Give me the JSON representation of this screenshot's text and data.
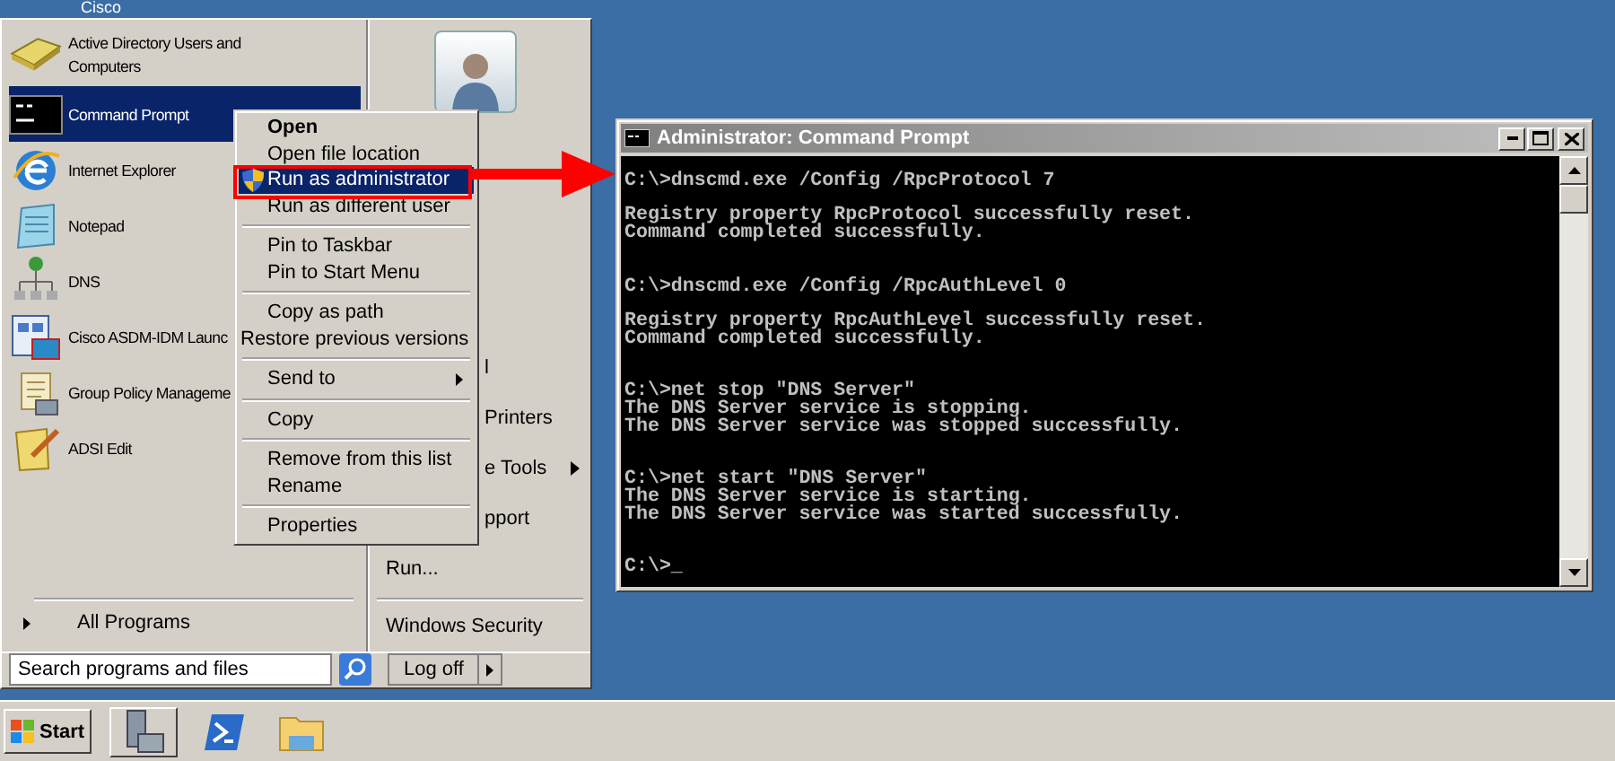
{
  "desktop": {
    "icon_label": "Cisco"
  },
  "start_menu": {
    "programs": [
      {
        "label": "Active Directory Users and Computers",
        "selected": false
      },
      {
        "label": "Command Prompt",
        "selected": true
      },
      {
        "label": "Internet Explorer",
        "selected": false
      },
      {
        "label": "Notepad",
        "selected": false
      },
      {
        "label": "DNS",
        "selected": false
      },
      {
        "label": "Cisco ASDM-IDM Launc",
        "selected": false
      },
      {
        "label": "Group Policy Manageme",
        "selected": false
      },
      {
        "label": "ADSI Edit",
        "selected": false
      }
    ],
    "all_programs": "All Programs",
    "search": {
      "placeholder": "Search programs and files"
    },
    "right_items": [
      {
        "label": "l",
        "kind": "covered",
        "has_submenu": false
      },
      {
        "label": "Printers",
        "kind": "covered",
        "has_submenu": false
      },
      {
        "label": "e Tools",
        "kind": "covered",
        "has_submenu": true
      },
      {
        "label": "pport",
        "kind": "covered",
        "has_submenu": false
      },
      {
        "label": "Run...",
        "kind": "item",
        "has_submenu": false
      },
      {
        "label": "Windows Security",
        "kind": "item",
        "has_submenu": false
      }
    ],
    "log_off": "Log off"
  },
  "context_menu": {
    "groups": [
      [
        {
          "label": "Open",
          "default": true,
          "selected": false,
          "has_submenu": false
        },
        {
          "label": "Open file location",
          "default": false,
          "selected": false,
          "has_submenu": false
        },
        {
          "label": "Run as administrator",
          "default": false,
          "selected": true,
          "has_submenu": false
        },
        {
          "label": "Run as different user",
          "default": false,
          "selected": false,
          "has_submenu": false
        }
      ],
      [
        {
          "label": "Pin to Taskbar",
          "default": false,
          "selected": false,
          "has_submenu": false
        },
        {
          "label": "Pin to Start Menu",
          "default": false,
          "selected": false,
          "has_submenu": false
        }
      ],
      [
        {
          "label": "Copy as path",
          "default": false,
          "selected": false,
          "has_submenu": false
        },
        {
          "label": "Restore previous versions",
          "default": false,
          "selected": false,
          "has_submenu": false
        }
      ],
      [
        {
          "label": "Send to",
          "default": false,
          "selected": false,
          "has_submenu": true
        }
      ],
      [
        {
          "label": "Copy",
          "default": false,
          "selected": false,
          "has_submenu": false
        }
      ],
      [
        {
          "label": "Remove from this list",
          "default": false,
          "selected": false,
          "has_submenu": false
        },
        {
          "label": "Rename",
          "default": false,
          "selected": false,
          "has_submenu": false
        }
      ],
      [
        {
          "label": "Properties",
          "default": false,
          "selected": false,
          "has_submenu": false
        }
      ]
    ]
  },
  "console": {
    "title": "Administrator: Command Prompt",
    "blocks": [
      {
        "wide_gap": false,
        "lines": [
          "C:\\>dnscmd.exe /Config /RpcProtocol 7"
        ]
      },
      {
        "wide_gap": false,
        "lines": [
          "Registry property RpcProtocol successfully reset.",
          "Command completed successfully."
        ]
      },
      {
        "wide_gap": true,
        "lines": [
          "C:\\>dnscmd.exe /Config /RpcAuthLevel 0"
        ]
      },
      {
        "wide_gap": false,
        "lines": [
          "Registry property RpcAuthLevel successfully reset.",
          "Command completed successfully."
        ]
      },
      {
        "wide_gap": true,
        "lines": [
          "C:\\>net stop \"DNS Server\"",
          "The DNS Server service is stopping.",
          "The DNS Server service was stopped successfully."
        ]
      },
      {
        "wide_gap": true,
        "lines": [
          "C:\\>net start \"DNS Server\"",
          "The DNS Server service is starting.",
          "The DNS Server service was started successfully."
        ]
      },
      {
        "wide_gap": true,
        "lines": [
          "C:\\>_"
        ]
      }
    ]
  },
  "taskbar": {
    "start": "Start"
  }
}
